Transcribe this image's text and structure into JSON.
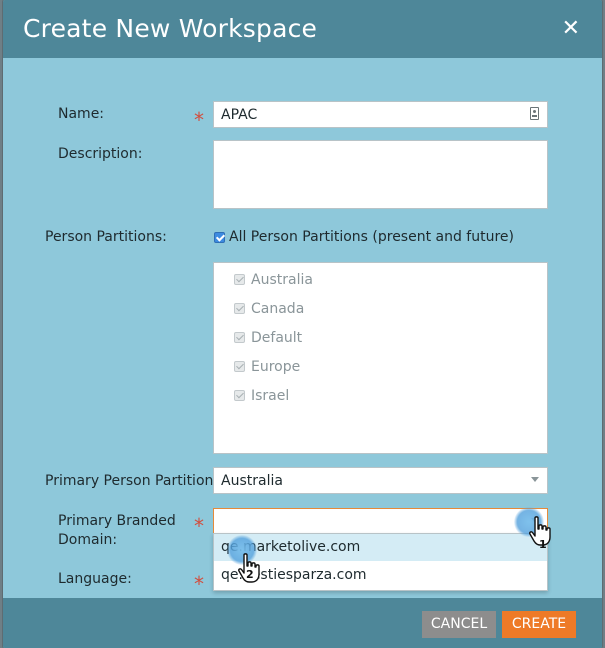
{
  "dialog": {
    "title": "Create New Workspace",
    "close_symbol": "✕"
  },
  "form": {
    "name": {
      "label": "Name:",
      "value": "APAC",
      "required_mark": "*",
      "icon": "contact-card-icon"
    },
    "description": {
      "label": "Description:",
      "value": ""
    },
    "person_partitions": {
      "label": "Person Partitions:",
      "all_label": "All Person Partitions (present and future)",
      "all_checked": true,
      "items": [
        {
          "label": "Australia",
          "checked": true
        },
        {
          "label": "Canada",
          "checked": true
        },
        {
          "label": "Default",
          "checked": true
        },
        {
          "label": "Europe",
          "checked": true
        },
        {
          "label": "Israel",
          "checked": true
        }
      ]
    },
    "primary_partition": {
      "label": "Primary Person Partition:",
      "value": "Australia"
    },
    "branded_domain": {
      "label_line1": "Primary Branded",
      "label_line2": "Domain:",
      "required_mark": "*",
      "value": "",
      "options": [
        "qe.marketolive.com",
        "qe.nestiesparza.com"
      ],
      "highlighted_index": 0
    },
    "language": {
      "label": "Language:",
      "required_mark": "*"
    }
  },
  "footer": {
    "cancel_label": "CANCEL",
    "create_label": "CREATE"
  },
  "annotations": {
    "step1": "1",
    "step2": "2"
  },
  "colors": {
    "header": "#4e8799",
    "body": "#8ec8da",
    "create_button": "#ee7a27",
    "cancel_button": "#8d8d8d",
    "required": "#d24d3d",
    "checkbox": "#3d8be0"
  }
}
